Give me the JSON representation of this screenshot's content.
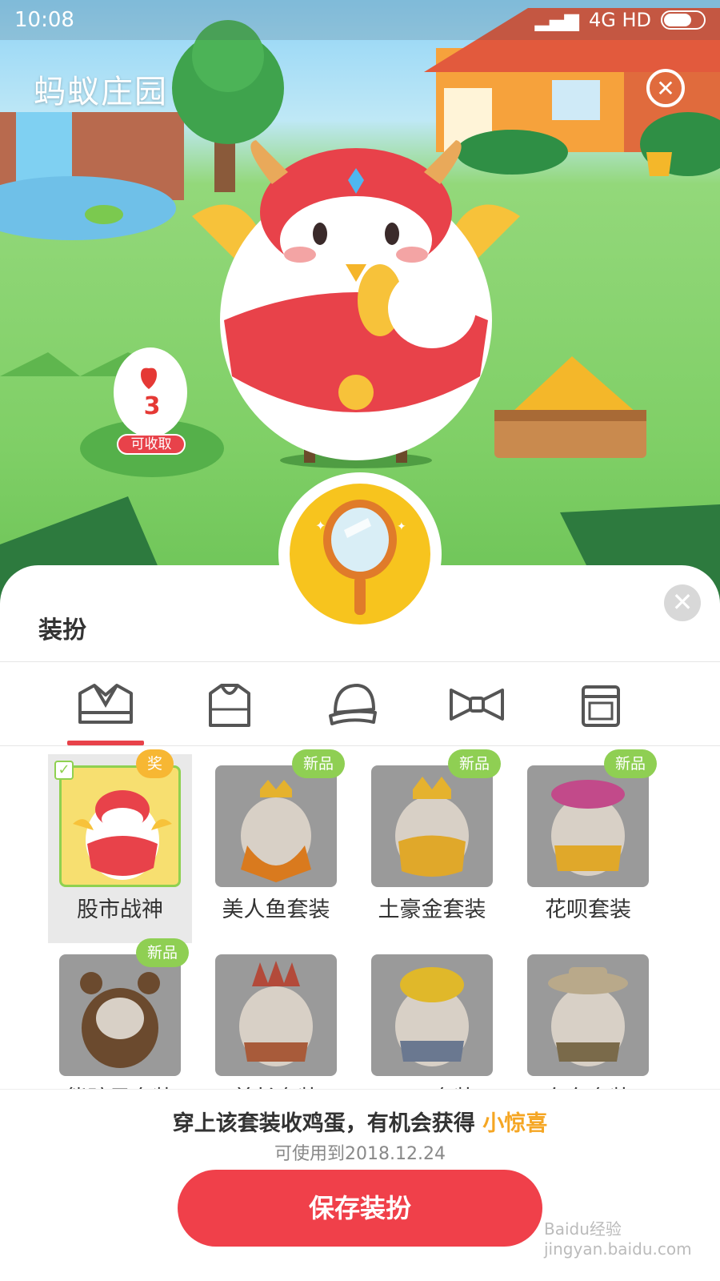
{
  "status_bar": {
    "time": "10:08",
    "network": "4G HD"
  },
  "app": {
    "title": "蚂蚁庄园"
  },
  "egg": {
    "count": "3",
    "collect_label": "可收取"
  },
  "panel": {
    "title": "装扮",
    "tabs": [
      {
        "name": "套装",
        "icon": "suit-icon"
      },
      {
        "name": "上衣",
        "icon": "hoodie-icon"
      },
      {
        "name": "帽子",
        "icon": "cap-icon"
      },
      {
        "name": "配饰",
        "icon": "bowtie-icon"
      },
      {
        "name": "背包",
        "icon": "bag-icon"
      }
    ],
    "active_tab": 0,
    "outfits": [
      {
        "label": "股市战神",
        "badge": "奖",
        "selected": true
      },
      {
        "label": "美人鱼套装",
        "badge": "新品"
      },
      {
        "label": "土豪金套装",
        "badge": "新品"
      },
      {
        "label": "花呗套装",
        "badge": "新品"
      },
      {
        "label": "熊孩子套装",
        "badge": "新品"
      },
      {
        "label": "首长套装",
        "badge": ""
      },
      {
        "label": "可可套装",
        "badge": ""
      },
      {
        "label": "东东套装",
        "badge": ""
      }
    ]
  },
  "footer": {
    "hint_prefix": "穿上该套装收鸡蛋，有机会获得 ",
    "hint_accent": "小惊喜",
    "expiry": "可使用到2018.12.24",
    "save_label": "保存装扮"
  },
  "watermark": "Baidu经验 jingyan.baidu.com",
  "colors": {
    "primary": "#f0404a",
    "accent": "#f5a623",
    "new_badge": "#8fcf53"
  }
}
